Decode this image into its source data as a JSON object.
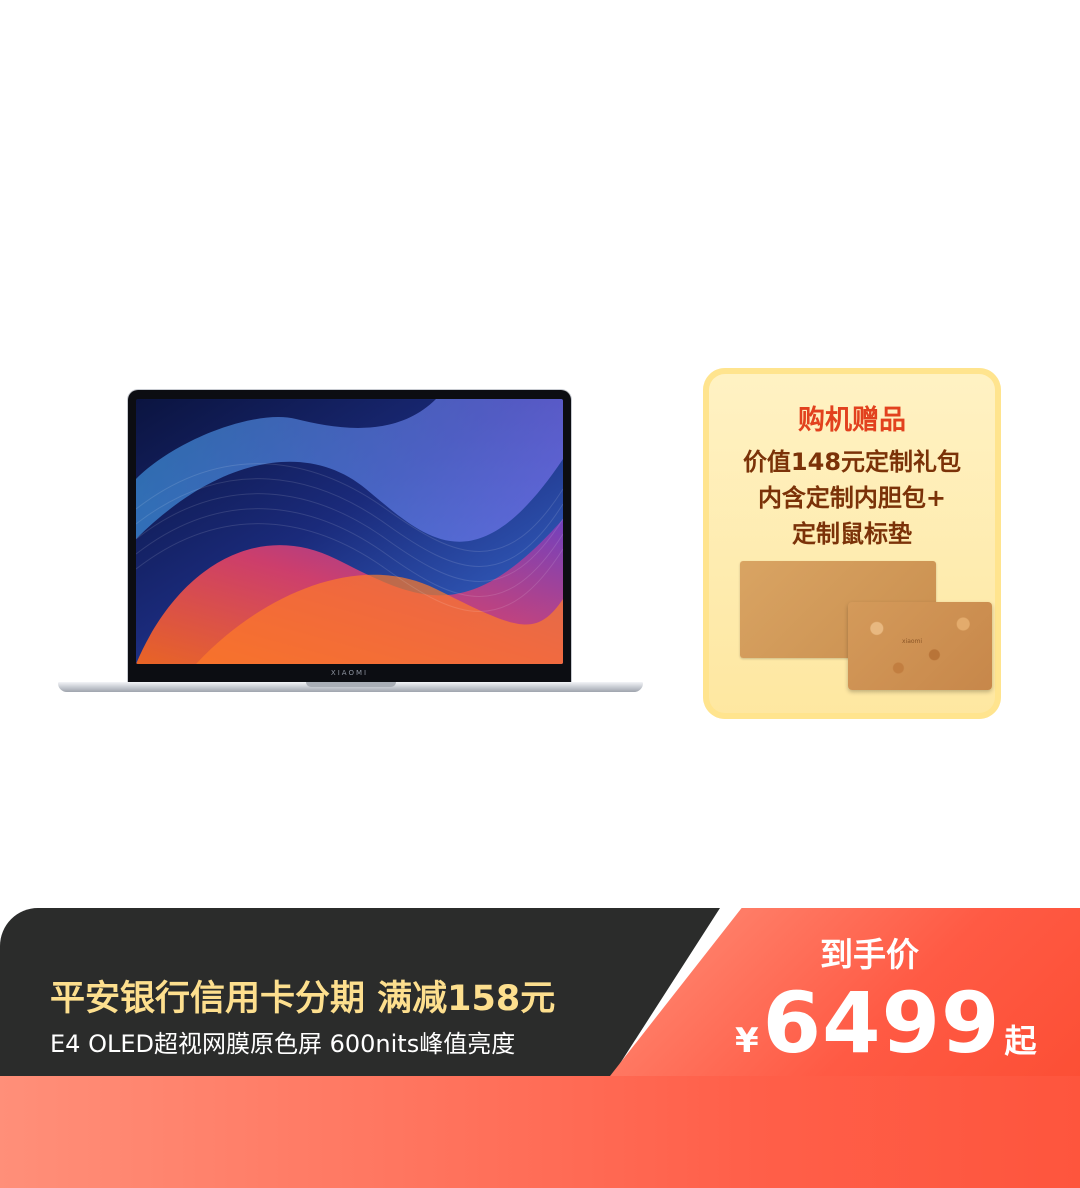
{
  "product": {
    "laptop_logo": "XIAOMI"
  },
  "gift": {
    "title": "购机赠品",
    "line1": "价值148元定制礼包",
    "line2": "内含定制内胆包+",
    "line3": "定制鼠标垫",
    "sleeve_logo": "xiaomi"
  },
  "promo": {
    "title": "平安银行信用卡分期 满减158元",
    "subtitle": "E4 OLED超视网膜原色屏 600nits峰值亮度"
  },
  "price": {
    "label": "到手价",
    "currency": "¥",
    "amount": "6499",
    "suffix": "起"
  },
  "colors": {
    "accent_orange": "#ff5f49",
    "gold_text": "#fddf8e",
    "dark_band": "#2b2c2b",
    "gift_title": "#e2411e",
    "gift_text": "#7b3208"
  }
}
